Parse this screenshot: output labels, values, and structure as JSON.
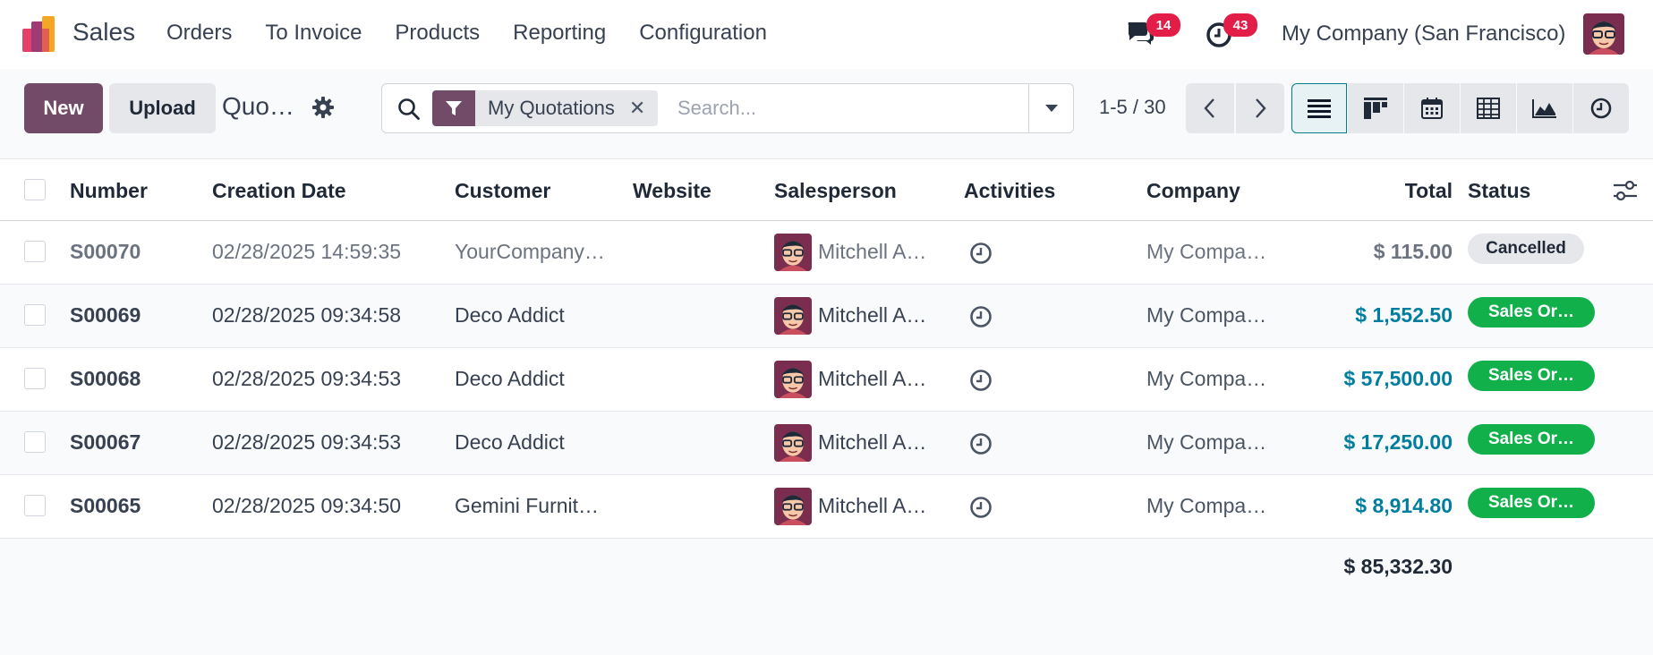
{
  "navbar": {
    "app_name": "Sales",
    "menu": [
      "Orders",
      "To Invoice",
      "Products",
      "Reporting",
      "Configuration"
    ],
    "messages_count": "14",
    "activities_count": "43",
    "company": "My Company (San Francisco)"
  },
  "control_panel": {
    "new_label": "New",
    "upload_label": "Upload",
    "title": "Quo…",
    "facet_label": "My Quotations",
    "search_placeholder": "Search...",
    "pager": "1-5 / 30",
    "views": [
      "list",
      "kanban",
      "calendar",
      "pivot",
      "graph",
      "activity"
    ],
    "active_view": "list"
  },
  "table": {
    "headers": {
      "number": "Number",
      "creation_date": "Creation Date",
      "customer": "Customer",
      "website": "Website",
      "salesperson": "Salesperson",
      "activities": "Activities",
      "company": "Company",
      "total": "Total",
      "status": "Status"
    },
    "rows": [
      {
        "number": "S00070",
        "date": "02/28/2025 14:59:35",
        "customer": "YourCompany…",
        "website": "",
        "salesperson": "Mitchell A…",
        "company": "My Compa…",
        "total": "$ 115.00",
        "status": "Cancelled"
      },
      {
        "number": "S00069",
        "date": "02/28/2025 09:34:58",
        "customer": "Deco Addict",
        "website": "",
        "salesperson": "Mitchell A…",
        "company": "My Compa…",
        "total": "$ 1,552.50",
        "status": "Sales Or…"
      },
      {
        "number": "S00068",
        "date": "02/28/2025 09:34:53",
        "customer": "Deco Addict",
        "website": "",
        "salesperson": "Mitchell A…",
        "company": "My Compa…",
        "total": "$ 57,500.00",
        "status": "Sales Or…"
      },
      {
        "number": "S00067",
        "date": "02/28/2025 09:34:53",
        "customer": "Deco Addict",
        "website": "",
        "salesperson": "Mitchell A…",
        "company": "My Compa…",
        "total": "$ 17,250.00",
        "status": "Sales Or…"
      },
      {
        "number": "S00065",
        "date": "02/28/2025 09:34:50",
        "customer": "Gemini Furnit…",
        "website": "",
        "salesperson": "Mitchell A…",
        "company": "My Compa…",
        "total": "$ 8,914.80",
        "status": "Sales Or…"
      }
    ],
    "grand_total": "$ 85,332.30"
  },
  "colors": {
    "brand": "#714b67",
    "link_total": "#017e9f",
    "badge": "#e11d48",
    "status_sales_order": "#12b04b",
    "cancelled_text": "#6b7280"
  }
}
